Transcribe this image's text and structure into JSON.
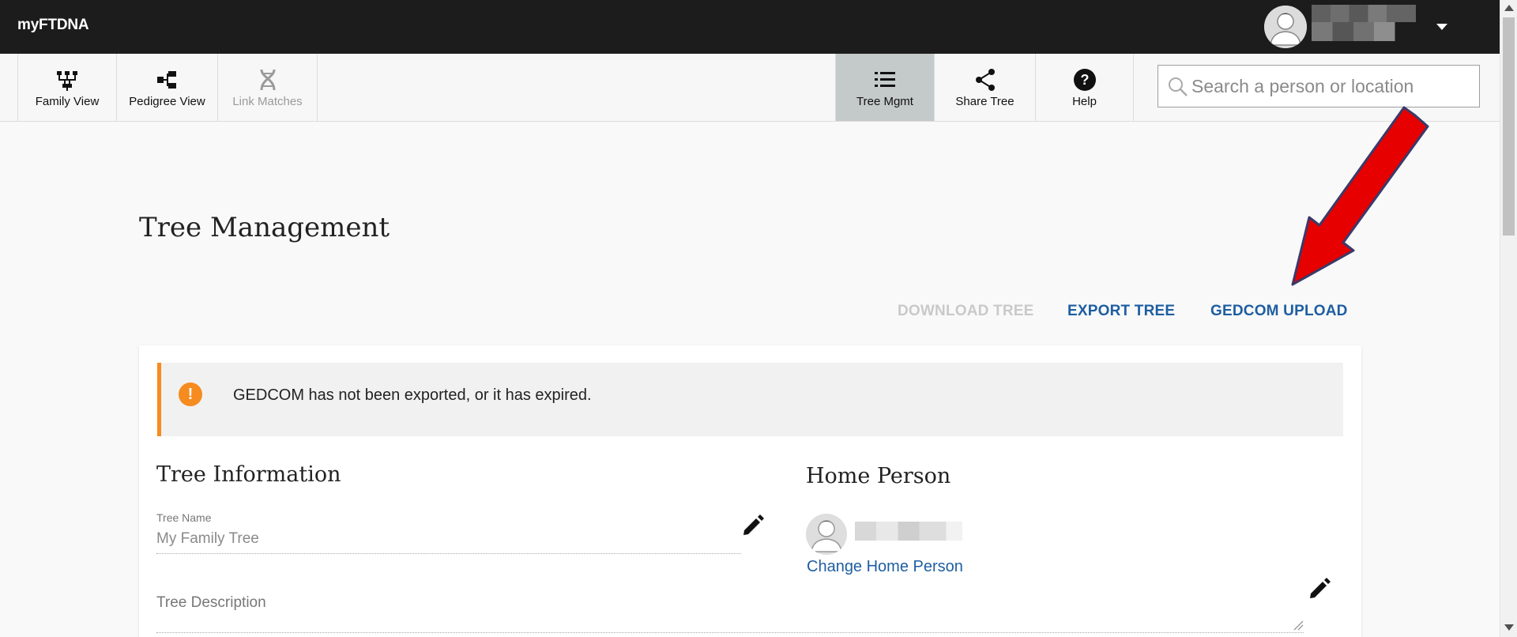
{
  "app": {
    "brand": "myFTDNA"
  },
  "user": {
    "avatar_icon": "user-avatar-icon",
    "menu_icon": "caret-down-icon"
  },
  "toolbar": {
    "left_buttons": [
      {
        "label": "Family View",
        "icon": "family-tree-icon"
      },
      {
        "label": "Pedigree View",
        "icon": "pedigree-icon"
      },
      {
        "label": "Link Matches",
        "icon": "dna-icon",
        "disabled": true
      }
    ],
    "right_buttons": [
      {
        "label": "Tree Mgmt",
        "icon": "list-icon",
        "active": true
      },
      {
        "label": "Share Tree",
        "icon": "share-icon"
      },
      {
        "label": "Help",
        "icon": "help-icon"
      }
    ],
    "search": {
      "placeholder": "Search a person or location",
      "value": "",
      "icon": "search-icon"
    }
  },
  "page": {
    "title": "Tree Management",
    "actions": {
      "download_tree": "DOWNLOAD TREE",
      "export_tree": "EXPORT TREE",
      "gedcom_upload": "GEDCOM UPLOAD"
    },
    "alert": {
      "text": "GEDCOM has not been exported, or it has expired.",
      "icon": "!"
    },
    "tree_info": {
      "heading": "Tree Information",
      "name_label": "Tree Name",
      "name_value": "My Family Tree",
      "description_label": "Tree Description"
    },
    "home_person": {
      "heading": "Home Person",
      "change_link": "Change Home Person"
    }
  },
  "colors": {
    "topbar": "#1c1c1c",
    "link": "#1e5ea1",
    "alert_accent": "#f68b1f",
    "annotation_arrow": "#e60000"
  }
}
